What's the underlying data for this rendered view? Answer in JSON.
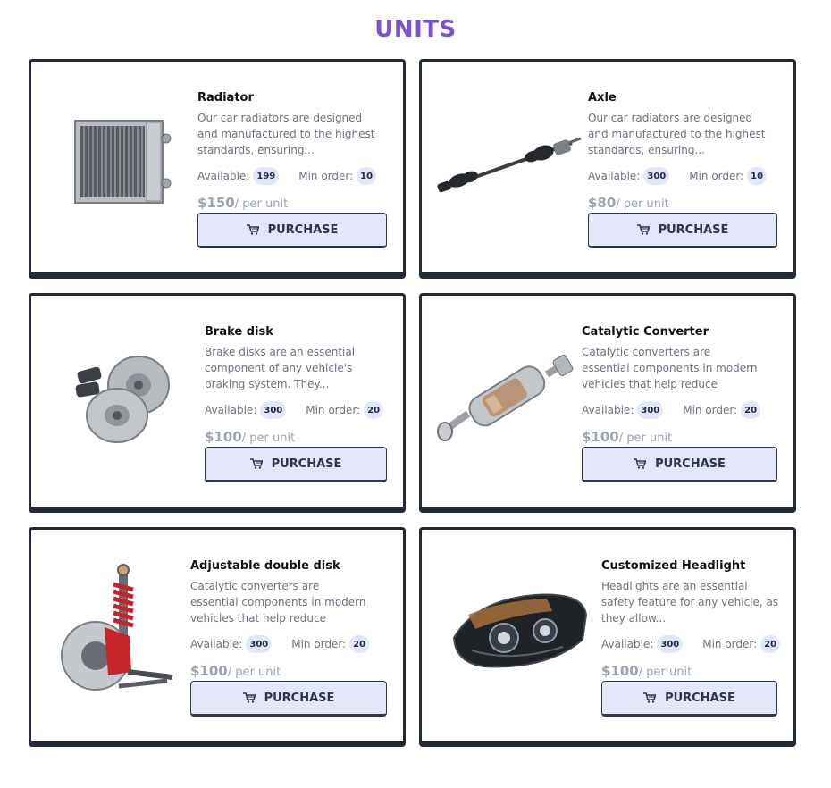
{
  "page": {
    "title": "UNITS"
  },
  "products": [
    {
      "name": "Radiator",
      "description": "Our car radiators are designed and manufactured to the highest standards, ensuring...",
      "available_label": "Available:",
      "available": "199",
      "min_order_label": "Min order:",
      "min_order": "10",
      "price": "$150",
      "price_unit": "/ per unit",
      "button_label": "PURCHASE",
      "icon": "radiator-image"
    },
    {
      "name": "Axle",
      "description": "Our car radiators are designed and manufactured to the highest standards, ensuring...",
      "available_label": "Available:",
      "available": "300",
      "min_order_label": "Min order:",
      "min_order": "10",
      "price": "$80",
      "price_unit": "/ per unit",
      "button_label": "PURCHASE",
      "icon": "axle-image"
    },
    {
      "name": "Brake disk",
      "description": "Brake disks are an essential component of any vehicle's braking system. They...",
      "available_label": "Available:",
      "available": "300",
      "min_order_label": "Min order:",
      "min_order": "20",
      "price": "$100",
      "price_unit": "/ per unit",
      "button_label": "PURCHASE",
      "icon": "brake-disk-image"
    },
    {
      "name": "Catalytic Converter",
      "description": "Catalytic converters are essential components in modern vehicles that help reduce harmful...",
      "available_label": "Available:",
      "available": "300",
      "min_order_label": "Min order:",
      "min_order": "20",
      "price": "$100",
      "price_unit": "/ per unit",
      "button_label": "PURCHASE",
      "icon": "catalytic-converter-image"
    },
    {
      "name": "Adjustable double disk",
      "description": "Catalytic converters are essential components in modern vehicles that help reduce harmful...",
      "available_label": "Available:",
      "available": "300",
      "min_order_label": "Min order:",
      "min_order": "20",
      "price": "$100",
      "price_unit": "/ per unit",
      "button_label": "PURCHASE",
      "icon": "suspension-image"
    },
    {
      "name": "Customized Headlight",
      "description": "Headlights are an essential safety feature for any vehicle, as they allow...",
      "available_label": "Available:",
      "available": "300",
      "min_order_label": "Min order:",
      "min_order": "20",
      "price": "$100",
      "price_unit": "/ per unit",
      "button_label": "PURCHASE",
      "icon": "headlight-image"
    }
  ],
  "colors": {
    "title": "#7b52d6",
    "border": "#222a3a",
    "button_bg": "#e4e7fc",
    "pill_bg": "#e3e7fb"
  }
}
